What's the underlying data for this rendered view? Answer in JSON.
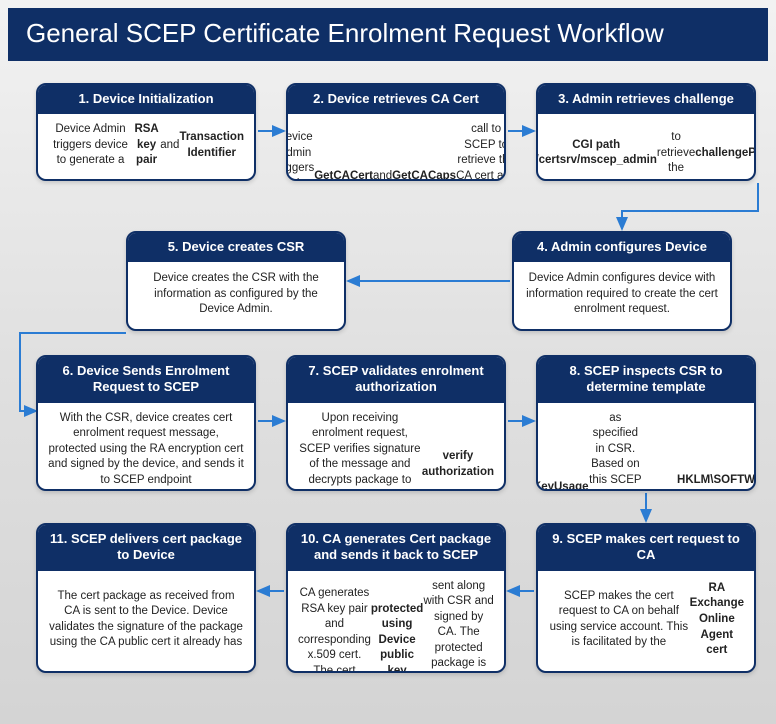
{
  "header": "General SCEP Certificate Enrolment Request Workflow",
  "steps": {
    "s1": {
      "title": "1. Device Initialization",
      "body": "Device Admin triggers device to generate a <b>RSA key pair</b> and <b>Transaction Identifier</b>"
    },
    "s2": {
      "title": "2. Device retrieves CA Cert",
      "body": "Device Admin triggers device to make a <b>GetCACert</b> and <b>GetCACaps</b> call to SCEP to retrieve the CA cert and CA supported capabilities."
    },
    "s3": {
      "title": "3. Admin retrieves challenge",
      "body": "Device Admin navigates to <b>CGI path /certsrv/mscep_admin</b> to retrieve the <b>challengePassword</b>."
    },
    "s4": {
      "title": "4. Admin configures Device",
      "body": "Device Admin configures device with information required to create the cert enrolment request."
    },
    "s5": {
      "title": "5. Device creates CSR",
      "body": "Device creates the CSR with the information as configured by the Device Admin."
    },
    "s6": {
      "title": "6. Device Sends Enrolment Request to SCEP",
      "body": "With the CSR, device creates cert enrolment request message, protected using the RA encryption cert and signed by the device, and sends it to SCEP endpoint"
    },
    "s7": {
      "title": "7. SCEP validates enrolment authorization",
      "body": "Upon receiving enrolment request, SCEP verifies signature of the message and decrypts package to retrieve challengePassword to <b>verify authorization</b>"
    },
    "s8": {
      "title": "8. SCEP inspects CSR to determine template",
      "body": "Template is determined by the <b>KeyUsage</b> as specified in CSR. Based on this SCEP chooses the template configured in <b>HKLM\\SOFTWARE\\ Microsoft\\Cryptography\\MSCEP</b>"
    },
    "s9": {
      "title": "9. SCEP makes cert request to CA",
      "body": "SCEP makes the cert request to CA on behalf using service account. This is facilitated by the <b>RA Exchange Online Agent cert</b>"
    },
    "s10": {
      "title": "10. CA generates Cert package and sends it back to SCEP",
      "body": "CA generates RSA key pair and corresponding x.509 cert. The cert package is <b>protected using Device public key</b> sent along with CSR and signed by CA. The protected package is returned to SCEP"
    },
    "s11": {
      "title": "11. SCEP delivers cert package to Device",
      "body": "The cert package as received from CA is sent to the Device. Device validates the signature of the package using the CA public cert it already has"
    }
  }
}
